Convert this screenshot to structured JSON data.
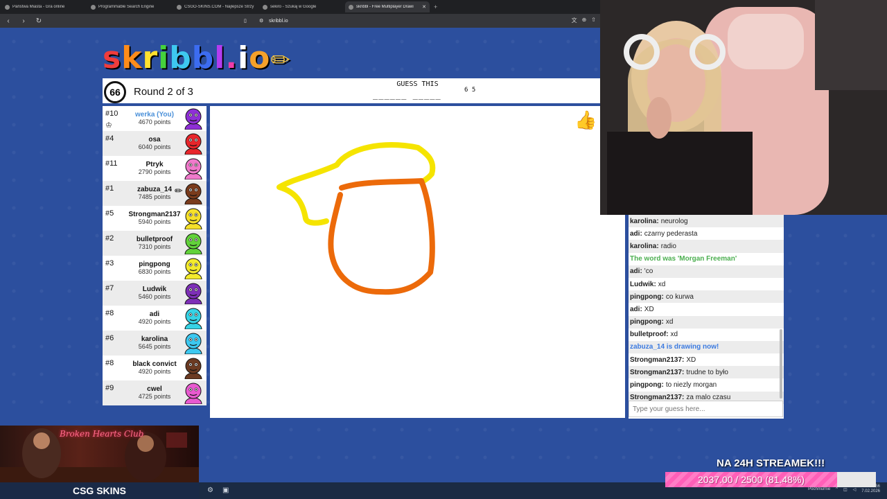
{
  "browser": {
    "tabs": [
      {
        "title": "Państwa Miasta - Gra online",
        "active": false
      },
      {
        "title": "Programmable Search Engine",
        "active": false
      },
      {
        "title": "CSGO-SKINS.COM - Najlepsze Strzy",
        "active": false
      },
      {
        "title": "sekiro - Szukaj w Google",
        "active": false
      },
      {
        "title": "skribbl - Free Multiplayer Drawi",
        "active": true
      }
    ],
    "new_tab": "+",
    "url": "skribbl.io"
  },
  "game": {
    "logo": "skribbl.io",
    "timer": "66",
    "round": "Round 2 of 3",
    "guess_label": "GUESS THIS",
    "hint": "______ _____",
    "hint_count": "6 5",
    "players": [
      {
        "rank": "#10",
        "name": "werka (You)",
        "points": "4670 points",
        "you": true,
        "crown": true,
        "color": "#8e2fd6"
      },
      {
        "rank": "#4",
        "name": "osa",
        "points": "6040 points",
        "color": "#e8262b"
      },
      {
        "rank": "#11",
        "name": "Ptryk",
        "points": "2790 points",
        "color": "#f07acb"
      },
      {
        "rank": "#1",
        "name": "zabuza_14",
        "points": "7485 points",
        "drawing": true,
        "color": "#7a3b1c"
      },
      {
        "rank": "#5",
        "name": "Strongman2137",
        "points": "5940 points",
        "color": "#f5e02a"
      },
      {
        "rank": "#2",
        "name": "bulletproof",
        "points": "7310 points",
        "color": "#62d23a"
      },
      {
        "rank": "#3",
        "name": "pingpong",
        "points": "6830 points",
        "color": "#f3ea2c"
      },
      {
        "rank": "#7",
        "name": "Ludwik",
        "points": "5460 points",
        "color": "#7d2fb7"
      },
      {
        "rank": "#8",
        "name": "adi",
        "points": "4920 points",
        "color": "#36d3e5"
      },
      {
        "rank": "#6",
        "name": "karolina",
        "points": "5645 points",
        "color": "#3cc8f0"
      },
      {
        "rank": "#8",
        "name": "black convict",
        "points": "4920 points",
        "color": "#6b3a22"
      },
      {
        "rank": "#9",
        "name": "cwel",
        "points": "4725 points",
        "color": "#e85ad0"
      }
    ],
    "chat": [
      {
        "user": "karolina:",
        "text": "neurolog"
      },
      {
        "user": "adi:",
        "text": "czarny pederasta"
      },
      {
        "user": "karolina:",
        "text": "radio"
      },
      {
        "system": "The word was 'Morgan Freeman'",
        "kind": "green"
      },
      {
        "user": "adi:",
        "text": "'co"
      },
      {
        "user": "Ludwik:",
        "text": "xd"
      },
      {
        "user": "pingpong:",
        "text": "co kurwa"
      },
      {
        "user": "adi:",
        "text": "XD"
      },
      {
        "user": "pingpong:",
        "text": "xd"
      },
      {
        "user": "bulletproof:",
        "text": "xd"
      },
      {
        "system": "zabuza_14 is drawing now!",
        "kind": "blue"
      },
      {
        "user": "Strongman2137:",
        "text": "XD"
      },
      {
        "user": "Strongman2137:",
        "text": "trudne to było"
      },
      {
        "user": "pingpong:",
        "text": "to niezly morgan"
      },
      {
        "user": "Strongman2137:",
        "text": "za malo czasu"
      }
    ],
    "chat_placeholder": "Type your guess here..."
  },
  "overlay": {
    "ad_sign": "Broken Hearts Club",
    "ad_brand": "CSG SKINS",
    "goal_title": "NA 24H STREAMEK!!!",
    "goal_text": "2037.00 / 2500 (81.48%)",
    "goal_fraction": 0.8148,
    "clock_time": "22:56",
    "clock_date": "7.02.2026",
    "weather": "Pochmurnie"
  },
  "colors": {
    "background": "#2c4f9e",
    "chat_green": "#4caf50",
    "chat_blue": "#3b7ae0",
    "goal_pink": "#ff5fb8"
  }
}
